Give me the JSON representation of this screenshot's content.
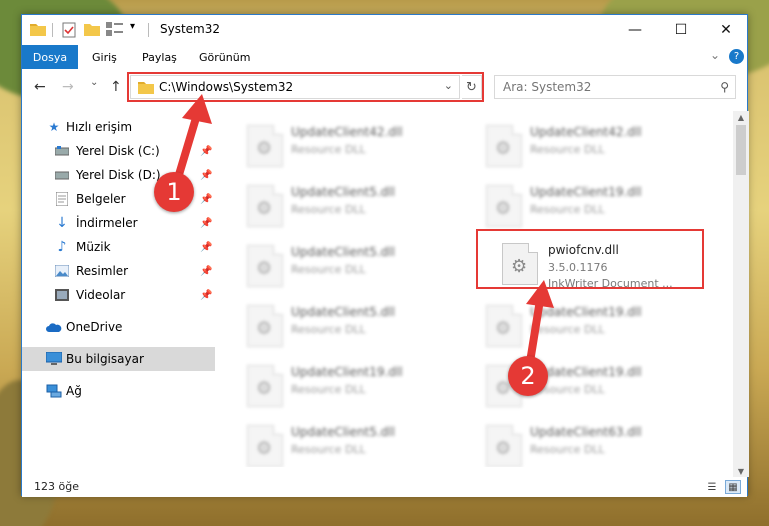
{
  "window": {
    "title": "System32",
    "minimize": "—",
    "maximize": "☐",
    "close": "✕"
  },
  "ribbon": {
    "tabs": [
      "Dosya",
      "Giriş",
      "Paylaş",
      "Görünüm"
    ],
    "help": "?"
  },
  "nav": {
    "back": "←",
    "forward": "→",
    "recent": "⌄",
    "up": "↑",
    "address": "C:\\Windows\\System32",
    "refresh": "↻",
    "search_placeholder": "Ara: System32"
  },
  "sidebar": {
    "items": [
      {
        "label": "Hızlı erişim",
        "icon": "star-icon"
      },
      {
        "label": "Yerel Disk (C:)",
        "icon": "drive-icon",
        "pinned": true
      },
      {
        "label": "Yerel Disk (D:)",
        "icon": "drive-icon",
        "pinned": true
      },
      {
        "label": "Belgeler",
        "icon": "documents-icon",
        "pinned": true
      },
      {
        "label": "İndirmeler",
        "icon": "download-icon",
        "pinned": true
      },
      {
        "label": "Müzik",
        "icon": "music-icon",
        "pinned": true
      },
      {
        "label": "Resimler",
        "icon": "pictures-icon",
        "pinned": true
      },
      {
        "label": "Videolar",
        "icon": "videos-icon",
        "pinned": true
      },
      {
        "label": "OneDrive",
        "icon": "cloud-icon"
      },
      {
        "label": "Bu bilgisayar",
        "icon": "computer-icon",
        "selected": true
      },
      {
        "label": "Ağ",
        "icon": "network-icon"
      }
    ]
  },
  "files": [
    {
      "name": "UpdateClient42.dll",
      "sub": "Resource DLL"
    },
    {
      "name": "UpdateClient42.dll",
      "sub": "Resource DLL"
    },
    {
      "name": "UpdateClient5.dll",
      "sub": "Resource DLL"
    },
    {
      "name": "UpdateClient19.dll",
      "sub": "Resource DLL"
    },
    {
      "name": "UpdateClient5.dll",
      "sub": "Resource DLL"
    },
    {
      "name": "pwiofcnv.dll",
      "sub": "3.5.0.1176",
      "sub2": "InkWriter Document ..."
    },
    {
      "name": "UpdateClient5.dll",
      "sub": "Resource DLL"
    },
    {
      "name": "UpdateClient19.dll",
      "sub": "Resource DLL"
    },
    {
      "name": "UpdateClient19.dll",
      "sub": "Resource DLL"
    },
    {
      "name": "UpdateClient19.dll",
      "sub": "Resource DLL"
    },
    {
      "name": "UpdateClient5.dll",
      "sub": "Resource DLL"
    },
    {
      "name": "UpdateClient63.dll",
      "sub": "Resource DLL"
    }
  ],
  "status": {
    "count": "123 öğe"
  },
  "annotations": {
    "step1": "1",
    "step2": "2",
    "color": "#e53935"
  },
  "colors": {
    "accent": "#1979ca",
    "highlight": "#e53935",
    "selected": "#d9d9d9"
  }
}
